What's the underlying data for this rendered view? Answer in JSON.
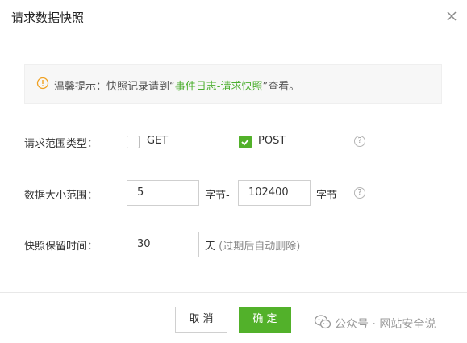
{
  "dialog": {
    "title": "请求数据快照"
  },
  "tip": {
    "prefix": "温馨提示：快照记录请到“",
    "link": "事件日志-请求快照",
    "suffix": "”查看。"
  },
  "request_type": {
    "label": "请求范围类型：",
    "options": [
      {
        "label": "GET",
        "checked": false
      },
      {
        "label": "POST",
        "checked": true
      }
    ]
  },
  "size_range": {
    "label": "数据大小范围：",
    "min_value": "5",
    "min_unit": "字节-",
    "max_value": "102400",
    "max_unit": "字节"
  },
  "retention": {
    "label": "快照保留时间：",
    "value": "30",
    "unit": "天",
    "hint": "(过期后自动删除)"
  },
  "footer": {
    "cancel_label": "取 消",
    "ok_label": "确 定"
  },
  "watermark": {
    "text": "公众号 · 网站安全说"
  },
  "colors": {
    "accent": "#52b12a",
    "link": "#4caf2f",
    "warning": "#f0a020"
  }
}
